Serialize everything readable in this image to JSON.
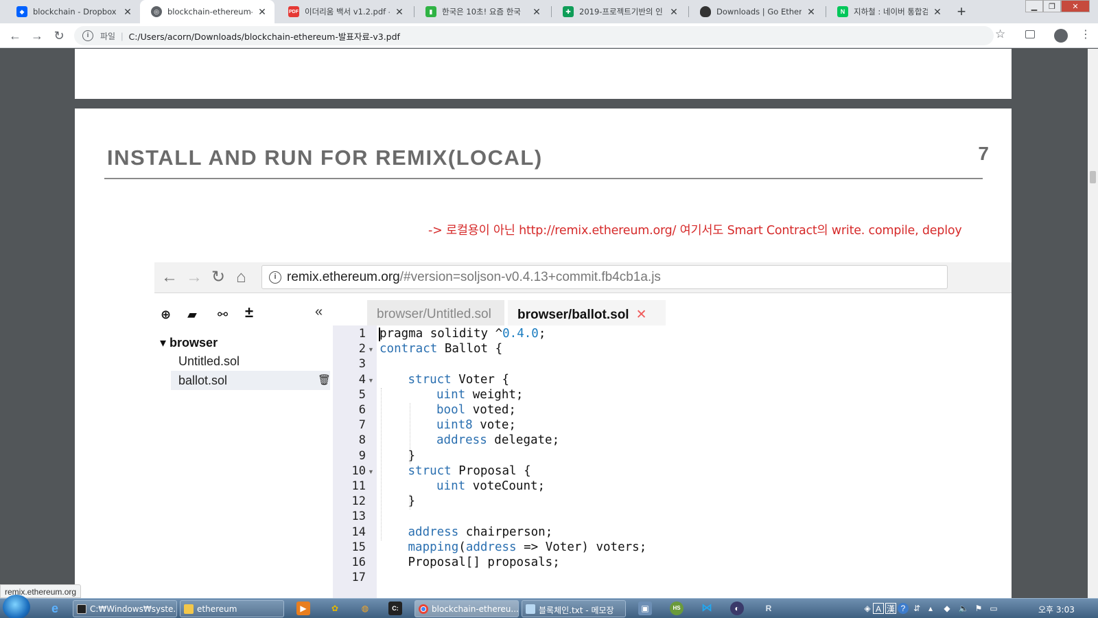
{
  "browser": {
    "tabs": [
      {
        "title": "blockchain - Dropbox",
        "icon": "dropbox-icon",
        "active": false
      },
      {
        "title": "blockchain-ethereum-발표",
        "icon": "globe-icon",
        "active": true
      },
      {
        "title": "이더리움 백서 v1.2.pdf -",
        "icon": "pdf-icon",
        "active": false
      },
      {
        "title": "한국은 10초! 요즘 한국",
        "icon": "bookmark-green-icon",
        "active": false
      },
      {
        "title": "2019-프로젝트기반의 인",
        "icon": "sheets-icon",
        "active": false
      },
      {
        "title": "Downloads | Go Ethereu",
        "icon": "geth-icon",
        "active": false
      },
      {
        "title": "지하철 : 네이버 통합검색",
        "icon": "naver-icon",
        "active": false
      }
    ],
    "new_tab_label": "+",
    "omnibox": {
      "scheme_label": "파일",
      "url": "C:/Users/acorn/Downloads/blockchain-ethereum-발표자료-v3.pdf"
    },
    "status_url": "remix.ethereum.org"
  },
  "slide": {
    "title": "INSTALL AND RUN FOR REMIX(LOCAL)",
    "page_number": "7",
    "note": "-> 로컬용이 아닌  http://remix.ethereum.org/ 여기서도 Smart Contract의 write. compile, deploy",
    "screenshot": {
      "url_host": "remix.ethereum.org",
      "url_path": "/#version=soljson-v0.4.13+commit.fb4cb1a.js",
      "tree": {
        "root": "browser",
        "files": [
          "Untitled.sol",
          "ballot.sol"
        ]
      },
      "editor_tabs": [
        "browser/Untitled.sol",
        "browser/ballot.sol"
      ],
      "code_lines": [
        {
          "n": "1",
          "indent": 0,
          "parts": [
            [
              "",
              "pragma solidity ^"
            ],
            [
              "num",
              "0.4.0"
            ],
            [
              "",
              ";"
            ]
          ]
        },
        {
          "n": "2",
          "indent": 0,
          "fold": true,
          "parts": [
            [
              "kw",
              "contract"
            ],
            [
              "",
              " Ballot {"
            ]
          ]
        },
        {
          "n": "3",
          "indent": 0,
          "parts": []
        },
        {
          "n": "4",
          "indent": 1,
          "fold": true,
          "parts": [
            [
              "kw",
              "struct"
            ],
            [
              "",
              " Voter {"
            ]
          ]
        },
        {
          "n": "5",
          "indent": 2,
          "parts": [
            [
              "kw",
              "uint"
            ],
            [
              "",
              " weight;"
            ]
          ]
        },
        {
          "n": "6",
          "indent": 2,
          "parts": [
            [
              "kw",
              "bool"
            ],
            [
              "",
              " voted;"
            ]
          ]
        },
        {
          "n": "7",
          "indent": 2,
          "parts": [
            [
              "kw",
              "uint8"
            ],
            [
              "",
              " vote;"
            ]
          ]
        },
        {
          "n": "8",
          "indent": 2,
          "parts": [
            [
              "kw",
              "address"
            ],
            [
              "",
              " delegate;"
            ]
          ]
        },
        {
          "n": "9",
          "indent": 1,
          "parts": [
            [
              "",
              "}"
            ]
          ]
        },
        {
          "n": "10",
          "indent": 1,
          "fold": true,
          "parts": [
            [
              "kw",
              "struct"
            ],
            [
              "",
              " Proposal {"
            ]
          ]
        },
        {
          "n": "11",
          "indent": 2,
          "parts": [
            [
              "kw",
              "uint"
            ],
            [
              "",
              " voteCount;"
            ]
          ]
        },
        {
          "n": "12",
          "indent": 1,
          "parts": [
            [
              "",
              "}"
            ]
          ]
        },
        {
          "n": "13",
          "indent": 0,
          "parts": []
        },
        {
          "n": "14",
          "indent": 1,
          "parts": [
            [
              "kw",
              "address"
            ],
            [
              "",
              " chairperson;"
            ]
          ]
        },
        {
          "n": "15",
          "indent": 1,
          "parts": [
            [
              "kw",
              "mapping"
            ],
            [
              "",
              "("
            ],
            [
              "kw",
              "address"
            ],
            [
              "",
              " => Voter) voters;"
            ]
          ]
        },
        {
          "n": "16",
          "indent": 1,
          "parts": [
            [
              "",
              "Proposal[] proposals;"
            ]
          ]
        },
        {
          "n": "17",
          "indent": 0,
          "parts": []
        }
      ]
    }
  },
  "taskbar": {
    "items": [
      {
        "label": "C:₩Windows₩syste...",
        "icon": "cmd-icon",
        "active": false
      },
      {
        "label": "ethereum",
        "icon": "folder-icon",
        "active": false
      },
      {
        "label": "blockchain-ethereu...",
        "icon": "chrome-icon",
        "active": true
      },
      {
        "label": "블록체인.txt - 메모장",
        "icon": "notepad-icon",
        "active": false
      }
    ],
    "clock": "오후 3:03"
  },
  "colors": {
    "note_red": "#d62a2a",
    "keyword_blue": "#2a6fb0",
    "title_gray": "#6b6b6b"
  }
}
